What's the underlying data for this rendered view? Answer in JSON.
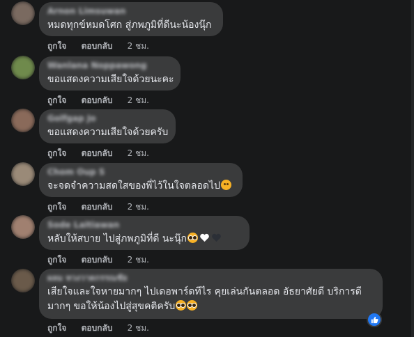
{
  "actions": {
    "like": "ถูกใจ",
    "reply": "ตอบกลับ",
    "time": "2 ชม."
  },
  "colors": {
    "background": "#18191a",
    "bubble": "#3a3b3c",
    "text": "#e4e6eb",
    "muted": "#b0b3b8",
    "like_blue": "#2078f4"
  },
  "comments": [
    {
      "name": "Arnon Limsuwan",
      "text": "หมดทุกข์หมดโศก สู่ภพภูมิที่ดีนะน้องนุ๊ก",
      "avatar_color": "#7a6a60"
    },
    {
      "name": "Wanlana Noppawong",
      "text": "ขอแสดงความเสียใจด้วยนะคะ",
      "avatar_color": "#6f8a4c"
    },
    {
      "name": "Golfgap Jo",
      "text": "ขอแสดงความเสียใจด้วยครับ",
      "avatar_color": "#8a6a5a"
    },
    {
      "name": "Chom Oup S",
      "text": "จะจดจำความสดใสของพี่ไว้ในใจตลอดไป",
      "avatar_color": "#9a8a78",
      "emoji": "sad-face-icon"
    },
    {
      "name": "Sode Laitiawan",
      "text": "หลับให้สบาย ไปสู่ภพภูมิที่ดี ",
      "text_tail": "นะนุ๊ก",
      "avatar_color": "#a08070",
      "emoji": "pleading-face-icon"
    },
    {
      "name": "ผลม ทวงวาดกรรณชัย",
      "text_line1": "เสียใจและใจหายมากๆ ไปเดอพาร์ดทีไร คุยเล่นกันตลอด อัธยาศัยดี บริการดี",
      "text_line2": "มากๆ ขอให้น้องไปสู่สุขคติครับ",
      "avatar_color": "#6a5a4a",
      "emoji": "pleading-face-icon",
      "reaction": "like-icon"
    }
  ]
}
